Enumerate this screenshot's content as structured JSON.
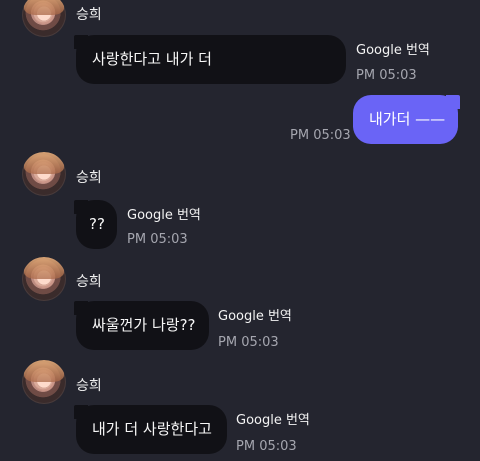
{
  "contact": {
    "name": "승희"
  },
  "messages": [
    {
      "direction": "incoming",
      "text": "사랑한다고 내가 더",
      "translate_label": "Google 번역",
      "time": "PM 05:03"
    },
    {
      "direction": "outgoing",
      "text": "내가더 ——",
      "time": "PM 05:03"
    },
    {
      "direction": "incoming",
      "text": "??",
      "translate_label": "Google 번역",
      "time": "PM 05:03"
    },
    {
      "direction": "incoming",
      "text": "싸울껀가 나랑??",
      "translate_label": "Google 번역",
      "time": "PM 05:03"
    },
    {
      "direction": "incoming",
      "text": "내가 더 사랑한다고",
      "translate_label": "Google 번역",
      "time": "PM 05:03"
    }
  ],
  "colors": {
    "background": "#24252f",
    "incoming_bubble": "#111116",
    "outgoing_bubble": "#6a64f6",
    "timestamp": "#a5a6af"
  }
}
